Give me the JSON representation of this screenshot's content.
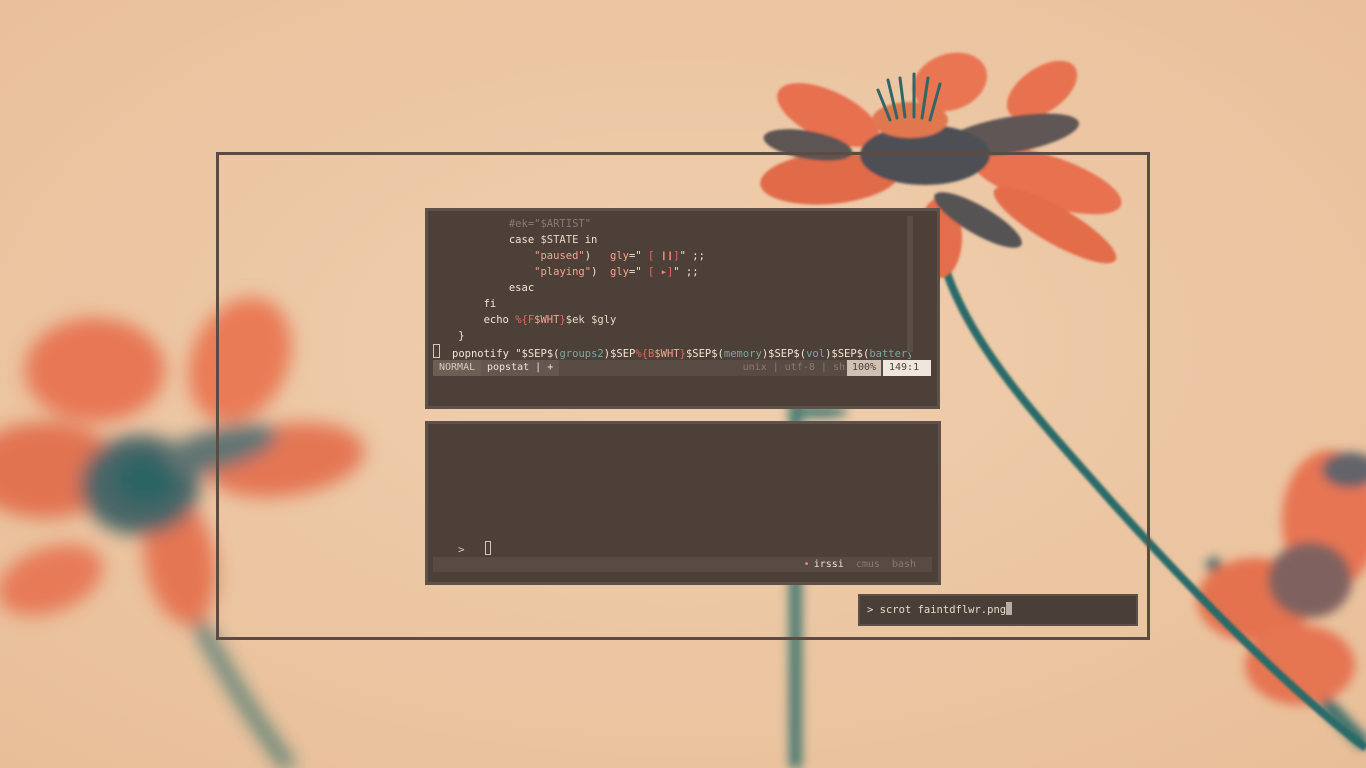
{
  "colors": {
    "wallpaper_bg": "#ecc7a1",
    "petal": "#e7714f",
    "stem": "#2b6766",
    "terminal_bg": "#4c4038",
    "terminal_border": "#5e5149",
    "frame_border": "#5b4b42",
    "accent_red": "#e06c5b",
    "accent_teal": "#79a8a3"
  },
  "editor": {
    "code_lines": [
      [
        {
          "t": "            ",
          "c": ""
        },
        {
          "t": "#ek=\"$ARTIST\"",
          "c": "c-comment"
        }
      ],
      [
        {
          "t": "            ",
          "c": ""
        },
        {
          "t": "case ",
          "c": "c-kw"
        },
        {
          "t": "$STATE",
          "c": "c-var"
        },
        {
          "t": " in",
          "c": "c-kw"
        }
      ],
      [
        {
          "t": "                ",
          "c": ""
        },
        {
          "t": "\"paused\"",
          "c": "c-str"
        },
        {
          "t": ")   ",
          "c": "c-kw"
        },
        {
          "t": "gly",
          "c": "c-str"
        },
        {
          "t": "=\" ",
          "c": "c-kw"
        },
        {
          "t": "[ ",
          "c": "c-red"
        },
        {
          "t": "❙❙",
          "c": "c-bar"
        },
        {
          "t": "]",
          "c": "c-red"
        },
        {
          "t": "\" ;;",
          "c": "c-kw"
        }
      ],
      [
        {
          "t": "                ",
          "c": ""
        },
        {
          "t": "\"playing\"",
          "c": "c-str"
        },
        {
          "t": ")  ",
          "c": "c-kw"
        },
        {
          "t": "gly",
          "c": "c-str"
        },
        {
          "t": "=\" ",
          "c": "c-kw"
        },
        {
          "t": "[ ",
          "c": "c-red"
        },
        {
          "t": "▸",
          "c": "c-bar"
        },
        {
          "t": "]",
          "c": "c-red"
        },
        {
          "t": "\" ;;",
          "c": "c-kw"
        }
      ],
      [
        {
          "t": "            ",
          "c": ""
        },
        {
          "t": "esac",
          "c": "c-kw"
        }
      ],
      [
        {
          "t": "        ",
          "c": ""
        },
        {
          "t": "fi",
          "c": "c-kw"
        }
      ],
      [
        {
          "t": "        ",
          "c": ""
        },
        {
          "t": "echo ",
          "c": "c-kw"
        },
        {
          "t": "%{F",
          "c": "c-red"
        },
        {
          "t": "$WHT",
          "c": "c-str"
        },
        {
          "t": "}",
          "c": "c-red"
        },
        {
          "t": "$ek $gly",
          "c": "c-var"
        }
      ],
      [
        {
          "t": "    ",
          "c": ""
        },
        {
          "t": "}",
          "c": "c-kw"
        }
      ],
      [
        {
          "t": "CURSOR",
          "c": "cursor"
        },
        {
          "t": "popnotify ",
          "c": "c-kw"
        },
        {
          "t": "\"$SEP$(",
          "c": "c-kw"
        },
        {
          "t": "groups2",
          "c": "c-teal"
        },
        {
          "t": ")$SEP",
          "c": "c-kw"
        },
        {
          "t": "%{B",
          "c": "c-red"
        },
        {
          "t": "$WHT",
          "c": "c-str"
        },
        {
          "t": "}",
          "c": "c-red"
        },
        {
          "t": "$SEP$(",
          "c": "c-kw"
        },
        {
          "t": "memory",
          "c": "c-teal"
        },
        {
          "t": ")$SEP$(",
          "c": "c-kw"
        },
        {
          "t": "vol",
          "c": "c-teal"
        },
        {
          "t": ")$SEP$(",
          "c": "c-kw"
        },
        {
          "t": "batterystate",
          "c": "c-teal"
        },
        {
          "t": "→",
          "c": "c-red"
        }
      ]
    ],
    "statusline": {
      "mode": "NORMAL",
      "file": "popstat | +",
      "info": "unix | utf-8 | sh",
      "percent": "100%",
      "position": "149:1"
    }
  },
  "shell": {
    "prompt": ">",
    "tabs": [
      {
        "label": "irssi",
        "active": true
      },
      {
        "label": "cmus",
        "active": false
      },
      {
        "label": "bash",
        "active": false
      }
    ]
  },
  "launcher": {
    "prompt": ">",
    "command": "scrot faintdflwr.png"
  }
}
